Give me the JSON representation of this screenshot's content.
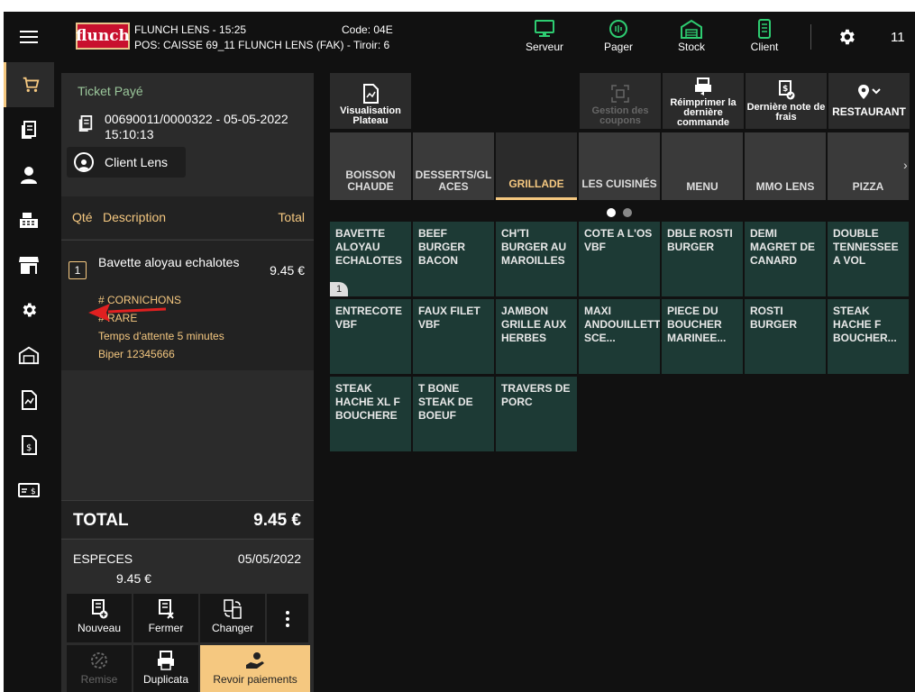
{
  "header": {
    "logo": "flunch",
    "store_line1": "FLUNCH LENS - 15:25",
    "store_line2": "POS: CAISSE 69_11 FLUNCH LENS (FAK) - Tiroir: 6",
    "code": "Code: 04E",
    "tools": [
      {
        "label": "Serveur",
        "icon": "monitor-icon"
      },
      {
        "label": "Pager",
        "icon": "pager-icon"
      },
      {
        "label": "Stock",
        "icon": "warehouse-icon"
      },
      {
        "label": "Client",
        "icon": "client-device-icon"
      }
    ],
    "number": "11",
    "accent": "#f5c880",
    "tool_color": "#2ecc71"
  },
  "ticket": {
    "status": "Ticket Payé",
    "number": "00690011/0000322 - 05-05-2022 15:10:13",
    "client_label": "Client Lens",
    "columns": {
      "qty": "Qté",
      "description": "Description",
      "total": "Total"
    },
    "item": {
      "qty": "1",
      "name": "Bavette aloyau echalotes",
      "price": "9.45 €",
      "modifiers": [
        "# CORNICHONS",
        "# RARE",
        "Temps d'attente 5 minutes",
        "Biper 12345666"
      ]
    },
    "total_label": "TOTAL",
    "total_value": "9.45 €",
    "payment_method": "ESPECES",
    "payment_date": "05/05/2022",
    "payment_amount": "9.45 €",
    "actions": {
      "new": "Nouveau",
      "close": "Fermer",
      "change": "Changer",
      "discount": "Remise",
      "duplicate": "Duplicata",
      "view_payments": "Revoir paiements"
    }
  },
  "toolbar": {
    "view_tray": "Visualisation Plateau",
    "coupons": "Gestion des coupons",
    "reprint": "Réimprimer la dernière commande",
    "expense_note": "Dernière note de frais",
    "restaurant": "RESTAURANT"
  },
  "categories": [
    "BOISSON CHAUDE",
    "DESSERTS/GLACES",
    "GRILLADE",
    "LES CUISINÉS",
    "MENU",
    "MMO LENS",
    "PIZZA"
  ],
  "active_category": "GRILLADE",
  "products": [
    "BAVETTE ALOYAU ECHALOTES",
    "BEEF BURGER BACON",
    "CH'TI BURGER AU MAROILLES",
    "COTE A L'OS VBF",
    "DBLE ROSTI BURGER",
    "DEMI MAGRET DE CANARD",
    "DOUBLE TENNESSEE A VOL",
    "ENTRECOTE VBF",
    "FAUX FILET VBF",
    "JAMBON GRILLE AUX HERBES",
    "MAXI ANDOUILLETTE SCE...",
    "PIECE DU BOUCHER MARINEE...",
    "ROSTI BURGER",
    "STEAK HACHE F BOUCHER...",
    "STEAK HACHE XL F BOUCHERE",
    "T BONE STEAK DE BOEUF",
    "TRAVERS DE PORC"
  ],
  "product_badge": "1"
}
